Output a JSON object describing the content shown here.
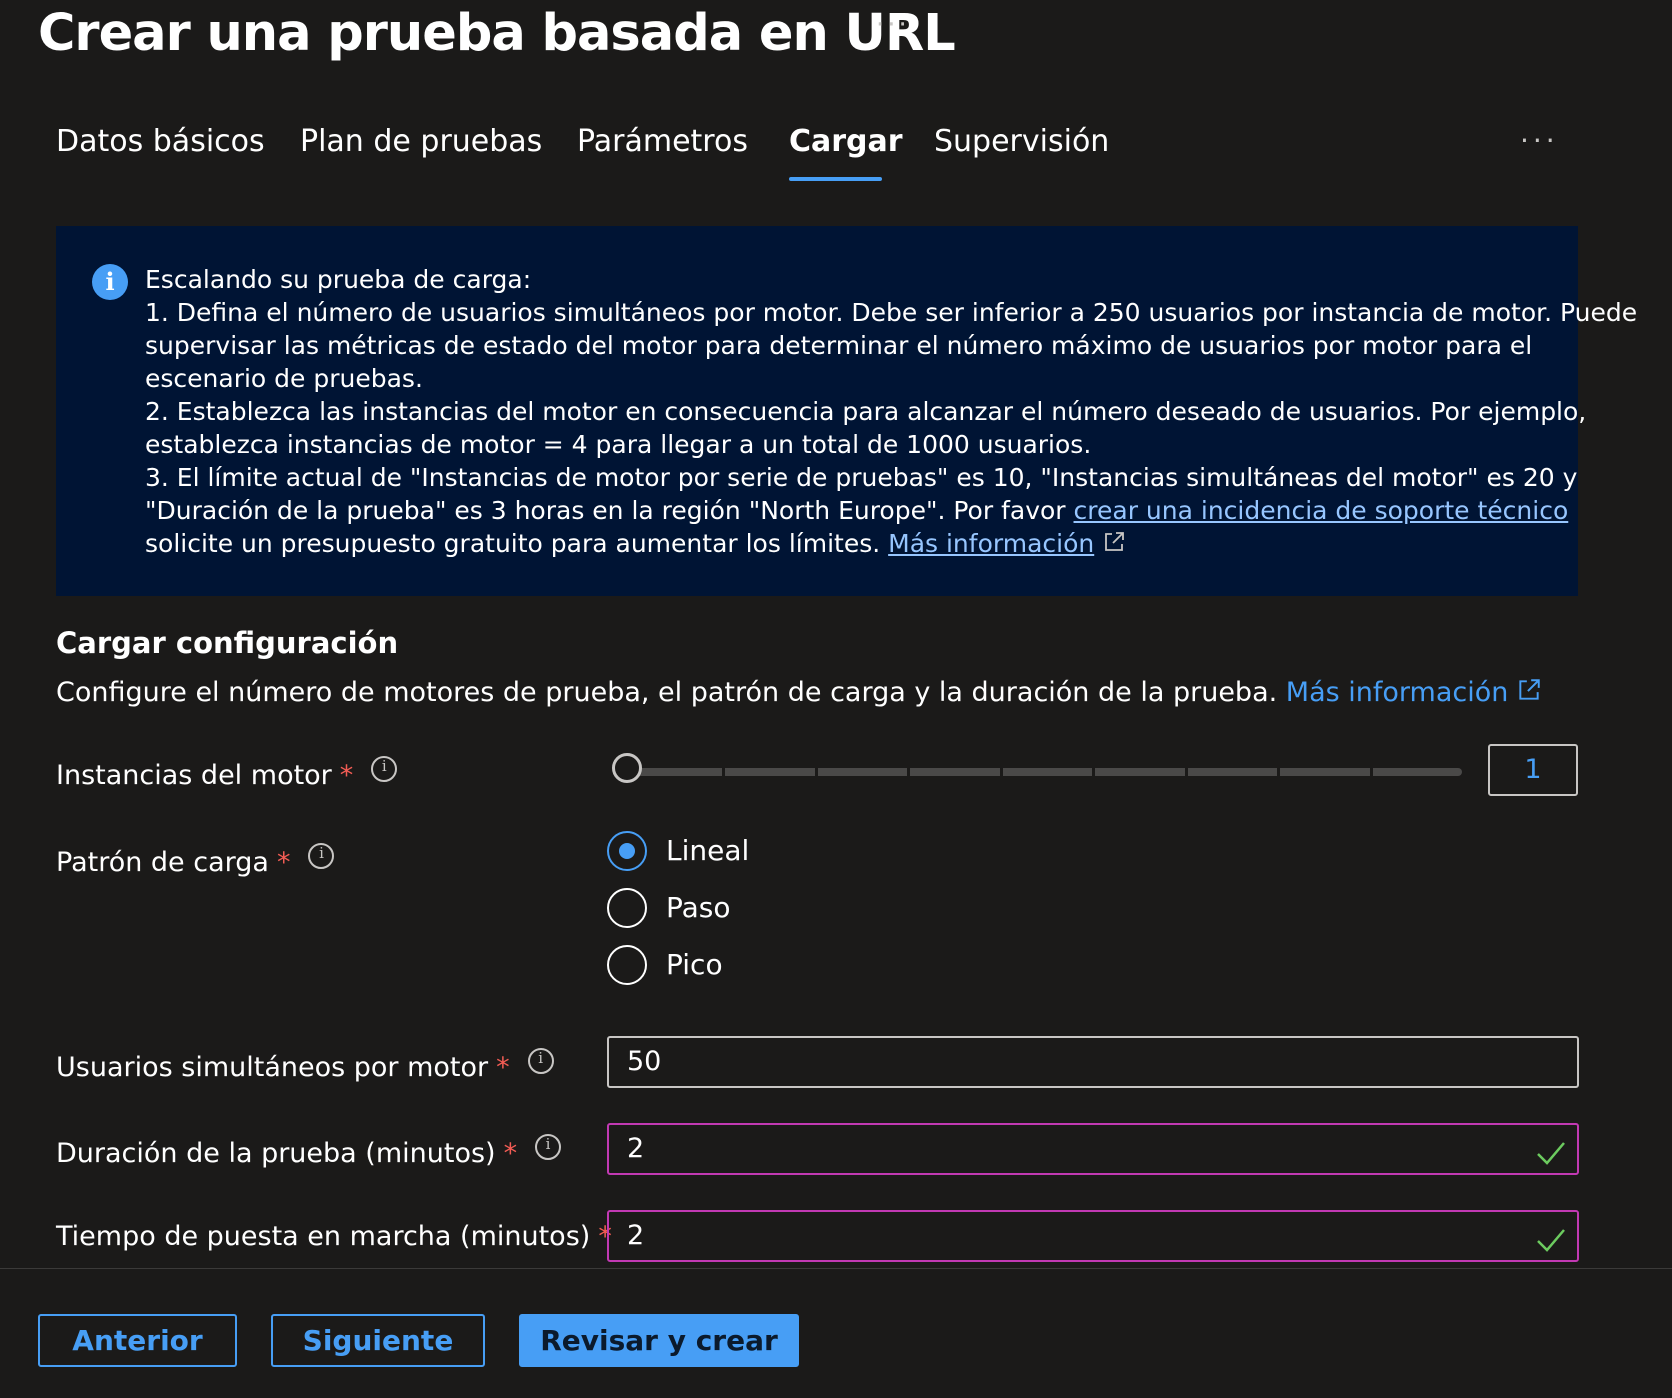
{
  "header": {
    "title": "Crear una prueba basada en URL",
    "more": "···"
  },
  "tabs": [
    {
      "label": "Datos básicos",
      "active": false
    },
    {
      "label": "Plan de pruebas",
      "active": false
    },
    {
      "label": "Parámetros",
      "active": false
    },
    {
      "label": "Cargar",
      "active": true
    },
    {
      "label": "Supervisión",
      "active": false
    }
  ],
  "tabs_more": "···",
  "info": {
    "icon": "info-icon",
    "line1": "Escalando su prueba de carga:",
    "line2": "1. Defina el número de usuarios simultáneos por motor. Debe ser inferior a 250 usuarios por instancia de motor. Puede",
    "line3": "supervisar las métricas de estado del motor para determinar el número máximo de usuarios por motor para el",
    "line4": "escenario de pruebas.",
    "line5": "2. Establezca las instancias del motor en consecuencia para alcanzar el número deseado de usuarios. Por ejemplo,",
    "line6": "establezca instancias de motor = 4 para llegar a un total de 1000 usuarios.",
    "line7": "3. El límite actual de \"Instancias de motor por serie de pruebas\" es 10, \"Instancias simultáneas del motor\" es 20 y",
    "line8_pre": "\"Duración de la prueba\" es 3 horas en la región \"North Europe\". Por favor ",
    "line8_link": "crear una incidencia de soporte técnico",
    "line9_pre": "solicite un presupuesto gratuito para aumentar los límites. ",
    "line9_link": "Más información"
  },
  "section": {
    "title": "Cargar configuración",
    "description": "Configure el número de motores de prueba, el patrón de carga y la duración de la prueba.",
    "link": "Más información"
  },
  "fields": {
    "engine_instances": {
      "label": "Instancias del motor",
      "required": "*",
      "value": "1",
      "slider_min": 1,
      "slider_max": 10
    },
    "load_pattern": {
      "label": "Patrón de carga",
      "required": "*",
      "options": [
        {
          "label": "Lineal",
          "checked": true
        },
        {
          "label": "Paso",
          "checked": false
        },
        {
          "label": "Pico",
          "checked": false
        }
      ]
    },
    "concurrent_users": {
      "label": "Usuarios simultáneos por motor",
      "required": "*",
      "value": "50"
    },
    "test_duration": {
      "label": "Duración de la prueba (minutos)",
      "required": "*",
      "value": "2"
    },
    "ramp_up": {
      "label": "Tiempo de puesta en marcha (minutos)",
      "required": "*",
      "value": "2"
    }
  },
  "footer": {
    "previous": "Anterior",
    "next": "Siguiente",
    "review_create": "Revisar y crear"
  },
  "colors": {
    "accent": "#479ef5",
    "background": "#1b1a19",
    "info_background": "#001434",
    "required": "#f25c54",
    "valid_border": "#c239b3",
    "valid_check": "#6ccb5f"
  }
}
